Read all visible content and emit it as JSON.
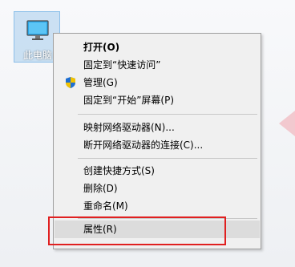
{
  "desktop": {
    "icon_label": "此电脑"
  },
  "menu": {
    "items": [
      {
        "label": "打开(O)"
      },
      {
        "label": "固定到“快速访问”"
      },
      {
        "label": "管理(G)",
        "icon": "shield-icon"
      },
      {
        "label": "固定到“开始”屏幕(P)"
      },
      {
        "label": "映射网络驱动器(N)..."
      },
      {
        "label": "断开网络驱动器的连接(C)..."
      },
      {
        "label": "创建快捷方式(S)"
      },
      {
        "label": "删除(D)"
      },
      {
        "label": "重命名(M)"
      },
      {
        "label": "属性(R)"
      }
    ]
  },
  "colors": {
    "highlight_box": "#e02020",
    "menu_bg": "#f0f0f0",
    "selected_item_bg": "#dcdcdc"
  }
}
